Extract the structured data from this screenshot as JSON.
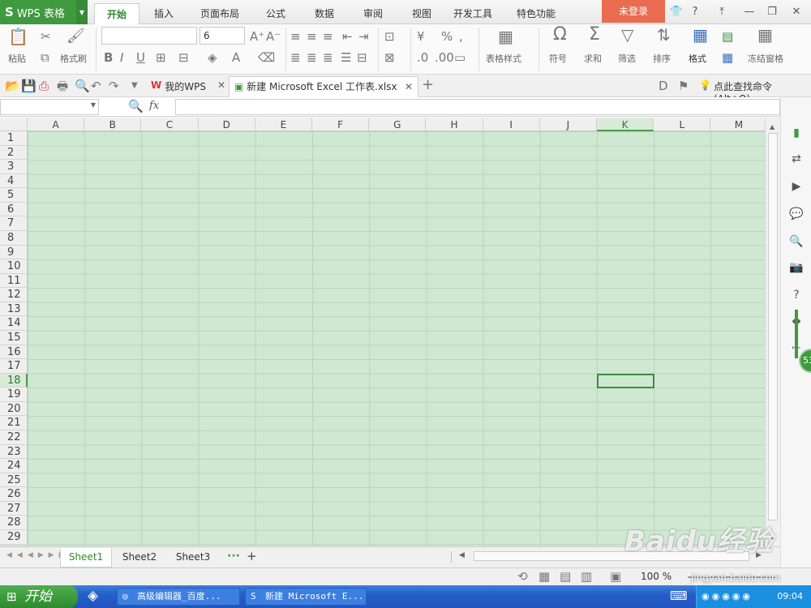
{
  "app": {
    "name": "WPS 表格",
    "logo": "S",
    "login_label": "未登录",
    "help_label": "?"
  },
  "menu_tabs": [
    "开始",
    "插入",
    "页面布局",
    "公式",
    "数据",
    "审阅",
    "视图",
    "开发工具",
    "特色功能"
  ],
  "ribbon": {
    "paste": "粘贴",
    "format_painter": "格式刷",
    "font_name": "",
    "font_size": "6",
    "bold": "B",
    "italic": "I",
    "underline": "U",
    "percent": "%",
    "table_style": "表格样式",
    "symbol": "符号",
    "sum": "求和",
    "filter": "筛选",
    "sort": "排序",
    "format": "格式",
    "freeze": "冻结窗格"
  },
  "doc_tabs": {
    "home": "我的WPS",
    "active": "新建 Microsoft Excel 工作表.xlsx",
    "search": "点此查找命令 (Alt+Q)"
  },
  "formula": {
    "name_box": "",
    "fx": "fx",
    "value": ""
  },
  "grid": {
    "columns": [
      "A",
      "B",
      "C",
      "D",
      "E",
      "F",
      "G",
      "H",
      "I",
      "J",
      "K",
      "L",
      "M"
    ],
    "rows": [
      "1",
      "2",
      "3",
      "4",
      "5",
      "6",
      "7",
      "8",
      "9",
      "10",
      "11",
      "12",
      "13",
      "14",
      "15",
      "16",
      "17",
      "18",
      "19",
      "20",
      "21",
      "22",
      "23",
      "24",
      "25",
      "26",
      "27",
      "28",
      "29"
    ],
    "selected_col": "K",
    "selected_row": "18"
  },
  "sheets": {
    "tabs": [
      "Sheet1",
      "Sheet2",
      "Sheet3"
    ],
    "active": "Sheet1",
    "add": "+"
  },
  "status": {
    "zoom": "100 %"
  },
  "side_badge": "53",
  "taskbar": {
    "start": "开始",
    "items": [
      "高级编辑器_百度...",
      "新建 Microsoft E..."
    ],
    "clock": "09:04"
  },
  "watermark": {
    "main": "Baidu经验",
    "sub": "jingyan.baidu.com"
  },
  "colors": {
    "accent": "#3f9a3f",
    "grid_bg": "#cfe8d2",
    "login": "#e96b50"
  }
}
